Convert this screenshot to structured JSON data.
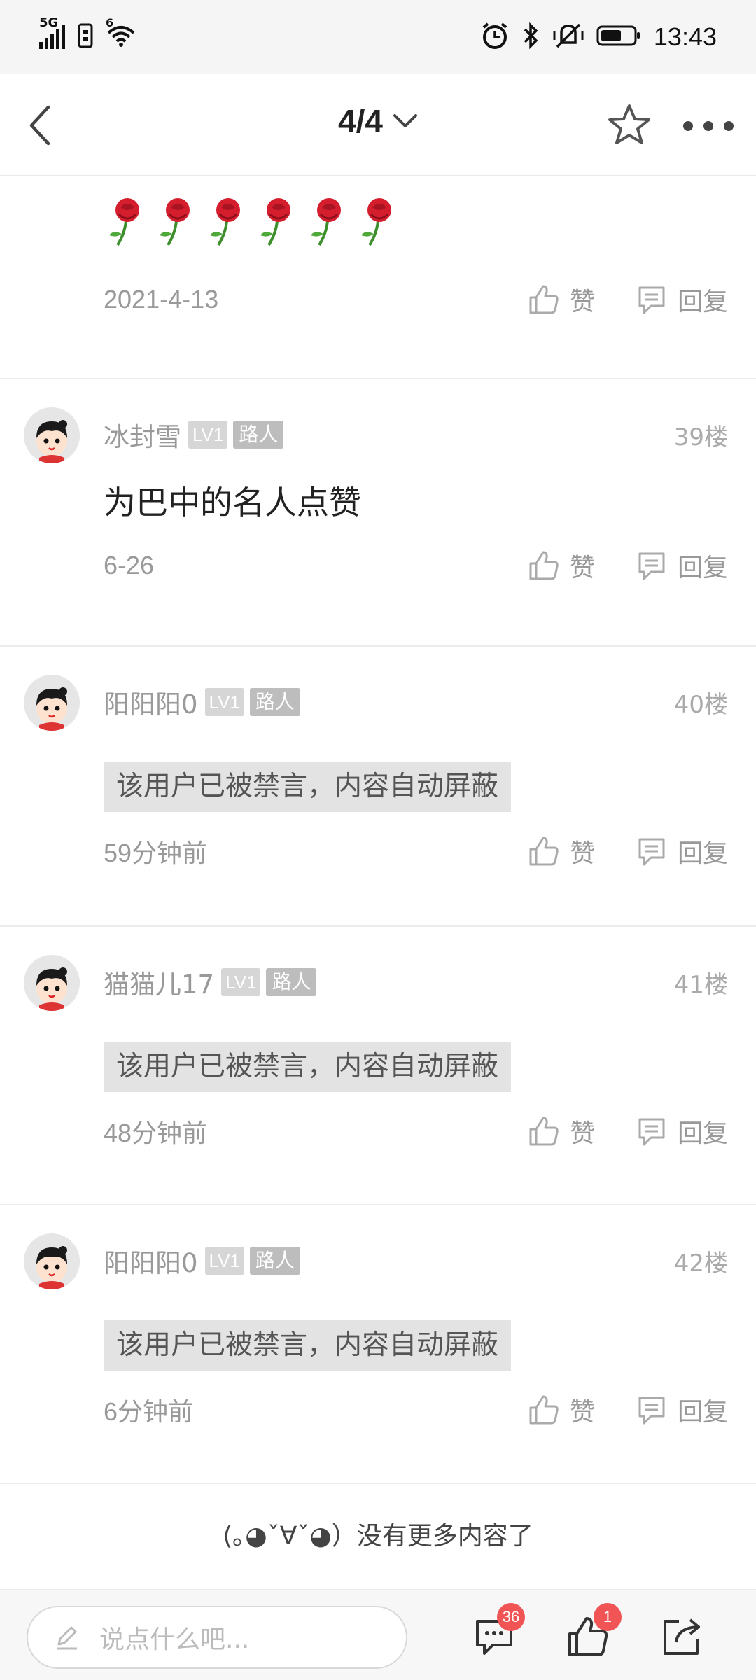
{
  "status_bar": {
    "network": "5G",
    "wifi_label": "6",
    "time": "13:43"
  },
  "header": {
    "page_indicator": "4/4"
  },
  "partial_post": {
    "date": "2021-4-13",
    "like_label": "赞",
    "reply_label": "回复"
  },
  "posts": [
    {
      "username": "冰封雪",
      "level": "LV1",
      "role": "路人",
      "floor": "39楼",
      "text": "为巴中的名人点赞",
      "muted": false,
      "time": "6-26",
      "like_label": "赞",
      "reply_label": "回复"
    },
    {
      "username": "阳阳阳0",
      "level": "LV1",
      "role": "路人",
      "floor": "40楼",
      "text": "该用户已被禁言，内容自动屏蔽",
      "muted": true,
      "time": "59分钟前",
      "like_label": "赞",
      "reply_label": "回复"
    },
    {
      "username": "猫猫儿17",
      "level": "LV1",
      "role": "路人",
      "floor": "41楼",
      "text": "该用户已被禁言，内容自动屏蔽",
      "muted": true,
      "time": "48分钟前",
      "like_label": "赞",
      "reply_label": "回复"
    },
    {
      "username": "阳阳阳0",
      "level": "LV1",
      "role": "路人",
      "floor": "42楼",
      "text": "该用户已被禁言，内容自动屏蔽",
      "muted": true,
      "time": "6分钟前",
      "like_label": "赞",
      "reply_label": "回复"
    }
  ],
  "footer_note": "(｡◕ˇ∀ˇ◕）没有更多内容了",
  "bottom_bar": {
    "input_placeholder": "说点什么吧...",
    "comment_count": "36",
    "like_count": "1"
  },
  "colors": {
    "badge_red": "#f05454",
    "muted_bg": "#e3e3e3"
  },
  "icons": [
    "back-icon",
    "chevron-down-icon",
    "star-icon",
    "more-icon",
    "thumb-up-icon",
    "reply-icon",
    "pencil-icon",
    "comment-icon",
    "share-icon",
    "rose-icon"
  ]
}
